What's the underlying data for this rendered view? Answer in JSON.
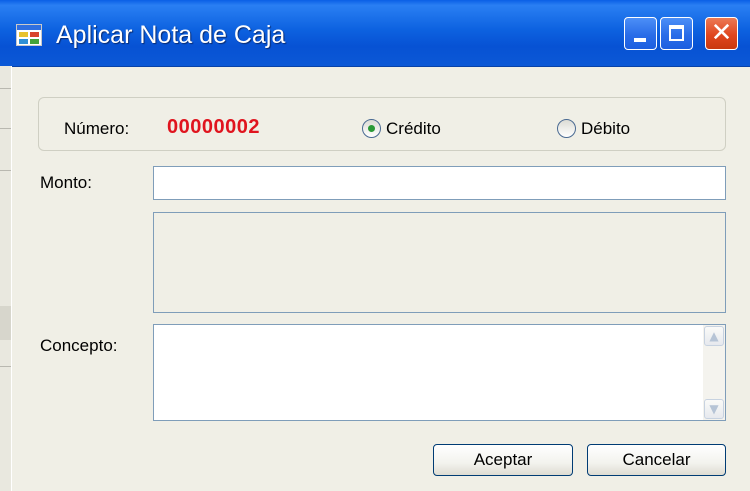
{
  "window": {
    "title": "Aplicar Nota de Caja",
    "icon": "app-window-icon",
    "controls": [
      "minimize-icon",
      "maximize-icon",
      "close-icon"
    ],
    "close_glyph": "✕"
  },
  "header": {
    "numero_label": "Número:",
    "numero_value": "00000002",
    "numero_color": "#e0141e",
    "tipo_options": [
      {
        "label": "Crédito",
        "selected": true
      },
      {
        "label": "Débito",
        "selected": false
      }
    ]
  },
  "form": {
    "monto_label": "Monto:",
    "monto_value": "",
    "concepto_label": "Concepto:",
    "concepto_value": ""
  },
  "scrollbar": {
    "up_glyph": "▲",
    "down_glyph": "▼"
  },
  "buttons": {
    "accept_label": "Aceptar",
    "cancel_label": "Cancelar"
  }
}
